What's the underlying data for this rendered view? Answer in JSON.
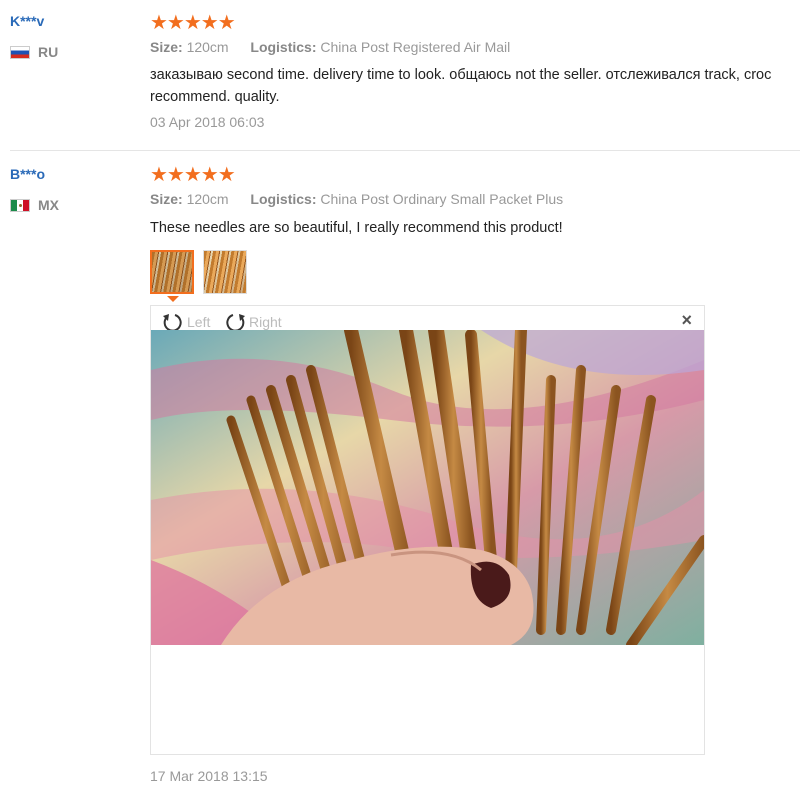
{
  "reviews": [
    {
      "user": "K***v",
      "country": "RU",
      "size_label": "Size:",
      "size_value": "120cm",
      "logistics_label": "Logistics:",
      "logistics_value": "China Post Registered Air Mail",
      "text_line1": "заказываю second time. delivery time to look. общаюсь not the seller. отслеживался track, croc",
      "text_line2": "recommend. quality.",
      "date": "03 Apr 2018 06:03",
      "rating": 5
    },
    {
      "user": "B***o",
      "country": "MX",
      "size_label": "Size:",
      "size_value": "120cm",
      "logistics_label": "Logistics:",
      "logistics_value": "China Post Ordinary Small Packet Plus",
      "text_line1": "These needles are so beautiful, I really recommend this product!",
      "date": "17 Mar 2018 13:15",
      "rating": 5
    }
  ],
  "viewer": {
    "rotate_left": "Left",
    "rotate_right": "Right",
    "close": "×"
  },
  "stars_text": "★★★★★",
  "colors": {
    "accent": "#f26e1e",
    "username": "#2a6ab8"
  }
}
